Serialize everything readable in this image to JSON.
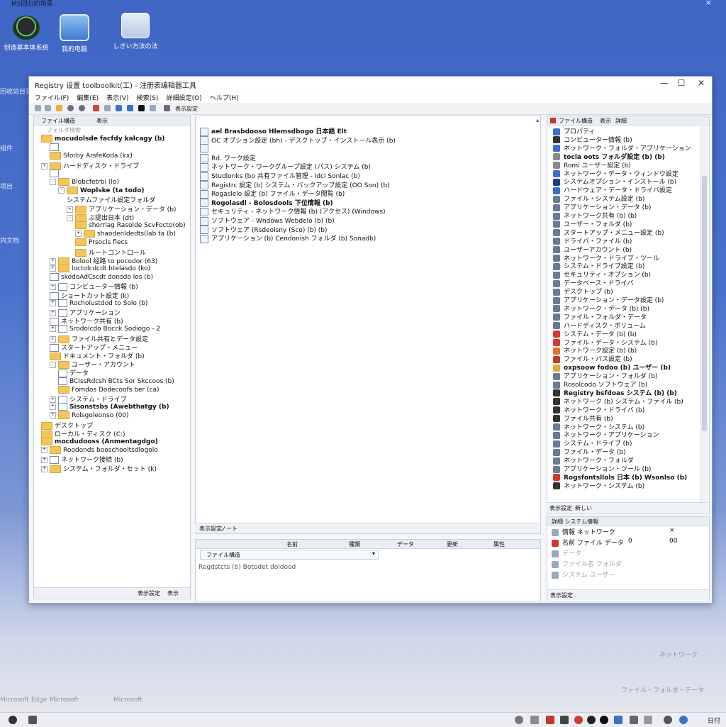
{
  "topbar": {
    "title": "MS回归的场景",
    "close": "×"
  },
  "desktop": {
    "icons": [
      {
        "label": "创造基本体系统"
      },
      {
        "label": "我的电脑"
      },
      {
        "label": "しきい方法の法"
      }
    ],
    "side_labels": [
      "回收站目录",
      "组件",
      "项目",
      "内文档"
    ]
  },
  "window": {
    "title": "Registry 设置 toolboolkit(工) - 注册表编辑器工具",
    "controls": {
      "minimize": "—",
      "maximize": "☐",
      "close": "✕"
    },
    "menu": [
      "ファイル(F)",
      "編集(E)",
      "表示(V)",
      "検索(S)",
      "詳細設定(O)",
      "ヘルプ(H)"
    ],
    "toolbar_label": "表示設定"
  },
  "left_pane": {
    "head_label": "ファイル構造",
    "head_tab": "表示",
    "search_placeholder": "フォルダ検索",
    "tree": [
      {
        "label": "mocudolsde facfdy kalcagy (b)",
        "bold": true,
        "indent": 0,
        "icon": "folder",
        "exp": ""
      },
      {
        "label": "",
        "indent": 1,
        "icon": "box",
        "exp": ""
      },
      {
        "label": "Sforby ArsfeKoda (kx)",
        "indent": 1,
        "icon": "folder",
        "exp": ""
      },
      {
        "label": "ハードディスク・ドライブ",
        "indent": 0,
        "icon": "folder",
        "exp": "+"
      },
      {
        "label": "",
        "indent": 1,
        "icon": "box",
        "exp": ""
      },
      {
        "label": "Blobcfetrbi (lo)",
        "indent": 1,
        "icon": "folder",
        "exp": "-"
      },
      {
        "label": "Woplske (ta todo)",
        "bold": true,
        "indent": 2,
        "icon": "folder",
        "exp": "-"
      },
      {
        "label": "システムファイル設定フォルダ",
        "indent": 3,
        "icon": "none",
        "exp": ""
      },
      {
        "label": "アプリケーション・データ (b)",
        "indent": 3,
        "icon": "folder",
        "exp": "+"
      },
      {
        "label": "ぷ提出日本 (dt)",
        "indent": 3,
        "icon": "folder",
        "exp": "-"
      },
      {
        "label": "shorrlag Rasolde ScvFocto(ob)",
        "indent": 4,
        "icon": "folder",
        "exp": ""
      },
      {
        "label": "shaodenldedts(lab ta (b)",
        "indent": 4,
        "icon": "folder",
        "exp": "+"
      },
      {
        "label": "Prsocls flecs",
        "indent": 4,
        "icon": "folder",
        "exp": ""
      },
      {
        "label": "ルートコントロール",
        "indent": 4,
        "icon": "folder",
        "exp": ""
      },
      {
        "label": "Bolool 经路 to pocodor (63)",
        "indent": 1,
        "icon": "folder",
        "exp": "+"
      },
      {
        "label": "loctolcdcdt htelasdo (ko)",
        "indent": 1,
        "icon": "folder",
        "exp": "+"
      },
      {
        "label": "skodoAdCscdt donsdo los (b)",
        "indent": 1,
        "icon": "box",
        "exp": ""
      },
      {
        "label": "コンピューター情報 (b)",
        "indent": 1,
        "icon": "box",
        "exp": "+"
      },
      {
        "label": "ショートカット設定 (k)",
        "indent": 1,
        "icon": "box",
        "exp": ""
      },
      {
        "label": "Rocholustdod to Solo (b)",
        "indent": 1,
        "icon": "box",
        "exp": "+"
      },
      {
        "label": "アプリケーション",
        "indent": 1,
        "icon": "box",
        "exp": "+"
      },
      {
        "label": "ネットワーク共有 (b)",
        "indent": 1,
        "icon": "box",
        "exp": ""
      },
      {
        "label": "Srodolcdo Bocck Sodiogo - 2",
        "indent": 1,
        "icon": "box",
        "exp": "+"
      },
      {
        "label": "ファイル共有とデータ設定",
        "indent": 1,
        "icon": "folder",
        "exp": "+"
      },
      {
        "label": "スタートアップ・メニュー",
        "indent": 1,
        "icon": "box",
        "exp": ""
      },
      {
        "label": "ドキュメント・フォルダ (b)",
        "indent": 1,
        "icon": "folder",
        "exp": ""
      },
      {
        "label": "ユーザー・アカウント",
        "indent": 1,
        "icon": "folder",
        "exp": "-"
      },
      {
        "label": "データ",
        "indent": 2,
        "icon": "box",
        "exp": ""
      },
      {
        "label": "BCIssRdcsh BCts Sor Skccoos (b)",
        "indent": 2,
        "icon": "box",
        "exp": ""
      },
      {
        "label": "Fomdos Dodecoofs ber (ca)",
        "indent": 2,
        "icon": "folder",
        "exp": ""
      },
      {
        "label": "システム・ドライブ",
        "indent": 1,
        "icon": "box",
        "exp": "+"
      },
      {
        "label": "Sisonstsbs (Awebthatgy (b)",
        "bold": true,
        "indent": 1,
        "icon": "box",
        "exp": "+"
      },
      {
        "label": "Rolsgoleonso (00)",
        "indent": 1,
        "icon": "folder",
        "exp": "+"
      },
      {
        "label": "デスクトップ",
        "indent": 0,
        "icon": "folder",
        "exp": ""
      },
      {
        "label": "ローカル・ディスク (C:)",
        "indent": 0,
        "icon": "folder",
        "exp": ""
      },
      {
        "label": "mocdudooss (Anmentagdgo)",
        "bold": true,
        "indent": 0,
        "icon": "folder",
        "exp": ""
      },
      {
        "label": "Roodonds booschooltsdlogolo",
        "indent": 0,
        "icon": "folder",
        "exp": "+"
      },
      {
        "label": "ネットワーク接続 (b)",
        "indent": 0,
        "icon": "box",
        "exp": "+"
      },
      {
        "label": "システム・フォルダ・セット (k)",
        "indent": 0,
        "icon": "folder",
        "exp": "+"
      }
    ],
    "status": [
      "表示設定",
      "表示"
    ]
  },
  "center_pane": {
    "list": [
      {
        "label": "ael Brasbdooso Hlemsdbogo 日本語 Elt",
        "bold": true
      },
      {
        "label": "OC オプション設定 (bh) - デスクトップ・インストール表示 (b)",
        "bold": false
      },
      {
        "label": "",
        "bold": false
      },
      {
        "label": "Rd. ワーク設定",
        "bold": false
      },
      {
        "label": "ネットワーク・ワークグループ設定 (パス) システム (b)",
        "bold": false
      },
      {
        "label": "Studlonks (bo 共有ファイル管理 - Idcl Sonlac (b)",
        "bold": false
      },
      {
        "label": "Registrc 設定 (b) システム・バックアップ設定 (OO Son) (b)",
        "bold": false
      },
      {
        "label": "Rogaslelo 設定 (b) ファイル・データ閲覧 (b)",
        "bold": false
      },
      {
        "label": "Rogolasdl - Bolosdools 下位情報 (b)",
        "bold": true
      },
      {
        "label": "セキュリティ - ネットワーク情報 (b) (アクセス) (Windows)",
        "bold": false
      },
      {
        "label": "ソフトウェア - Wndows Webdelo (b) (b)",
        "bold": false
      },
      {
        "label": "ソフトウェア (Rsdeolsny (Sco) (b) (b)",
        "bold": false
      },
      {
        "label": "アプリケーション (b) Cendonish フォルダ (b) Sonadb)",
        "bold": false
      }
    ],
    "status_left": "表示設定",
    "status_mid": "ノート"
  },
  "bottom_center": {
    "columns": [
      "名前",
      "種類",
      "データ",
      "更新",
      "属性"
    ],
    "dropdown": "ファイル構造",
    "text": "Regdstcts (b) Botodet doldood"
  },
  "right_pane": {
    "head": [
      "ファイル構造",
      "表示",
      "詳細"
    ],
    "items": [
      {
        "label": "プロパティ",
        "color": "#3b6fc9"
      },
      {
        "label": "コンピューター情報 (b)",
        "color": "#333333"
      },
      {
        "label": "ネットワーク・フォルダ・アプリケーション",
        "color": "#3b6fc9"
      },
      {
        "label": "tocla oots フォルダ設定 (b) (b)",
        "color": "#8a8a8a",
        "bold": true
      },
      {
        "label": "Romi ユーザー設定 (b)",
        "color": "#8a8a8a"
      },
      {
        "label": "ネットワーク・データ・ウィンドウ設定",
        "color": "#3b6fc9"
      },
      {
        "label": "システムオプション・インストール (b)",
        "color": "#1c3f8e"
      },
      {
        "label": "ハードウェア・データ・ドライバ設定",
        "color": "#3b6fc9"
      },
      {
        "label": "ファイル・システム設定 (b)",
        "color": "#6b7a93"
      },
      {
        "label": "アプリケーション・データ (b)",
        "color": "#6b7a93"
      },
      {
        "label": "ネットワーク共有 (b) (b)",
        "color": "#6b7a93"
      },
      {
        "label": "ユーザー・フォルダ (b)",
        "color": "#6b7a93"
      },
      {
        "label": "スタートアップ・メニュー設定 (b)",
        "color": "#6b7a93"
      },
      {
        "label": "ドライバ・ファイル (b)",
        "color": "#6b7a93"
      },
      {
        "label": "ユーザーアカウント (b)",
        "color": "#6b7a93"
      },
      {
        "label": "ネットワーク・ドライブ・ツール",
        "color": "#6b7a93"
      },
      {
        "label": "システム・ドライブ設定 (b)",
        "color": "#6b7a93"
      },
      {
        "label": "セキュリティ・オプション (b)",
        "color": "#6b7a93"
      },
      {
        "label": "データベース・ドライバ",
        "color": "#6b7a93"
      },
      {
        "label": "デスクトップ (b)",
        "color": "#6b7a93"
      },
      {
        "label": "アプリケーション・データ設定 (b)",
        "color": "#6b7a93"
      },
      {
        "label": "ネットワーク・データ (b) (b)",
        "color": "#6b7a93"
      },
      {
        "label": "ファイル・フォルダ・データ",
        "color": "#6b7a93"
      },
      {
        "label": "ハードディスク・ボリューム",
        "color": "#6b7a93"
      },
      {
        "label": "システム・データ (b) (b)",
        "color": "#d03a2f"
      },
      {
        "label": "ファイル・データ・システム (b)",
        "color": "#d03a2f"
      },
      {
        "label": "ネットワーク設定 (b) (b)",
        "color": "#e0722a"
      },
      {
        "label": "ファイル・パス設定 (b)",
        "color": "#c0392b"
      },
      {
        "label": "oxpsoow fodoo (b) ユーザー (b)",
        "color": "#e0a93a",
        "bold": true
      },
      {
        "label": "アプリケーション・フォルダ (b)",
        "color": "#6b7a93"
      },
      {
        "label": "Rosolcodo ソフトウェア (b)",
        "color": "#6b7a93"
      },
      {
        "label": "Registry bsfdoas システム (b) (b)",
        "color": "#333333",
        "bold": true
      },
      {
        "label": "ネットワーク (b) システム・ファイル (b)",
        "color": "#333333"
      },
      {
        "label": "ネットワーク・ドライバ (b)",
        "color": "#333333"
      },
      {
        "label": "ファイル共有 (b)",
        "color": "#333333"
      },
      {
        "label": "ネットワーク・システム (b)",
        "color": "#6b7a93"
      },
      {
        "label": "ネットワーク・アプリケーション",
        "color": "#6b7a93"
      },
      {
        "label": "システム・ドライブ (b)",
        "color": "#6b7a93"
      },
      {
        "label": "ファイル・データ (b)",
        "color": "#6b7a93"
      },
      {
        "label": "ネットワーク・フォルダ",
        "color": "#6b7a93"
      },
      {
        "label": "アプリケーション・ツール (b)",
        "color": "#6b7a93"
      },
      {
        "label": "Rogsfontsllols 日本 (b) Wsonlso (b)",
        "color": "#d03a2f",
        "bold": true
      },
      {
        "label": "ネットワーク・システム (b)",
        "color": "#333333"
      }
    ],
    "status": [
      "表示設定",
      "新しい"
    ]
  },
  "props_pane": {
    "head": "詳細 システム情報",
    "rows": [
      {
        "name": "情報 ネットワーク",
        "value": "",
        "flag": "×"
      },
      {
        "name": "名前 ファイル データ",
        "value": "0",
        "flag": "00"
      },
      {
        "name": "データ",
        "value": "",
        "flag": ""
      },
      {
        "name": "ファイル名 フォルダ",
        "value": "",
        "flag": ""
      },
      {
        "name": "システム ユーザー",
        "value": "",
        "flag": ""
      }
    ],
    "status": "表示設定"
  },
  "faded": {
    "desk_bottom": [
      "Microsoft Edge",
      "Microsoft",
      "Microsoft"
    ],
    "right_bottom": [
      "ファイル・フォルダ・データ",
      "ネットワーク"
    ]
  },
  "taskbar": {
    "time": "日付"
  }
}
